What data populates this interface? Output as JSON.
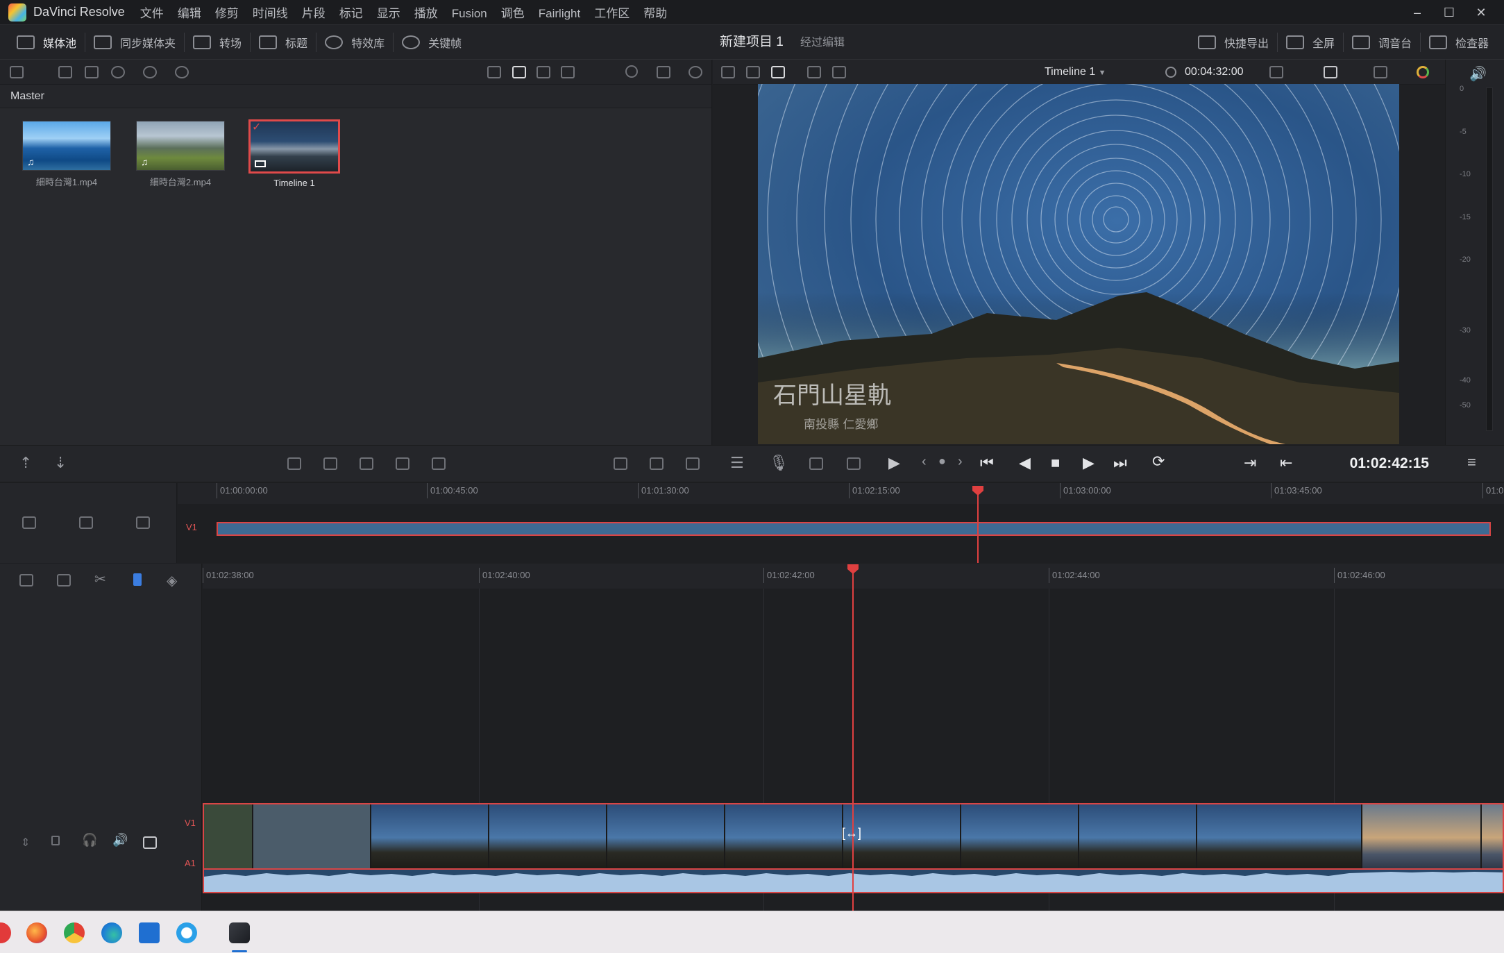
{
  "app": {
    "name": "DaVinci Resolve",
    "menu": [
      "文件",
      "编辑",
      "修剪",
      "时间线",
      "片段",
      "标记",
      "显示",
      "播放",
      "Fusion",
      "调色",
      "Fairlight",
      "工作区",
      "帮助"
    ]
  },
  "toolbar": {
    "buttons": [
      "媒体池",
      "同步媒体夹",
      "转场",
      "标题",
      "特效库",
      "关键帧"
    ],
    "project_title": "新建项目 1",
    "project_subtitle": "经过编辑",
    "right_buttons": [
      "快捷导出",
      "全屏",
      "调音台",
      "检查器"
    ]
  },
  "mediapool": {
    "bin": "Master",
    "clips": [
      {
        "name": "細時台灣1.mp4",
        "selected": false
      },
      {
        "name": "細時台灣2.mp4",
        "selected": false
      },
      {
        "name": "Timeline 1",
        "selected": true
      }
    ]
  },
  "viewer": {
    "timeline_name": "Timeline 1",
    "duration": "00:04:32:00",
    "overlay_title": "石門山星軌",
    "overlay_subtitle": "南投縣 仁愛鄉",
    "current_timecode": "01:02:42:15"
  },
  "meter": {
    "labels": [
      "0",
      "-5",
      "-10",
      "-15",
      "-20",
      "-30",
      "-40",
      "-50"
    ]
  },
  "overview_ruler": [
    "01:00:00:00",
    "01:00:45:00",
    "01:01:30:00",
    "01:02:15:00",
    "01:03:00:00",
    "01:03:45:00",
    "01:0"
  ],
  "timeline_ruler": [
    "01:02:38:00",
    "01:02:40:00",
    "01:02:42:00",
    "01:02:44:00",
    "01:02:46:00"
  ],
  "tracks": {
    "overview_video": "V1",
    "video": "V1",
    "audio": "A1"
  },
  "colors": {
    "accent_red": "#e04040",
    "clip_blue": "#3d6a93",
    "background": "#1e1f22"
  }
}
